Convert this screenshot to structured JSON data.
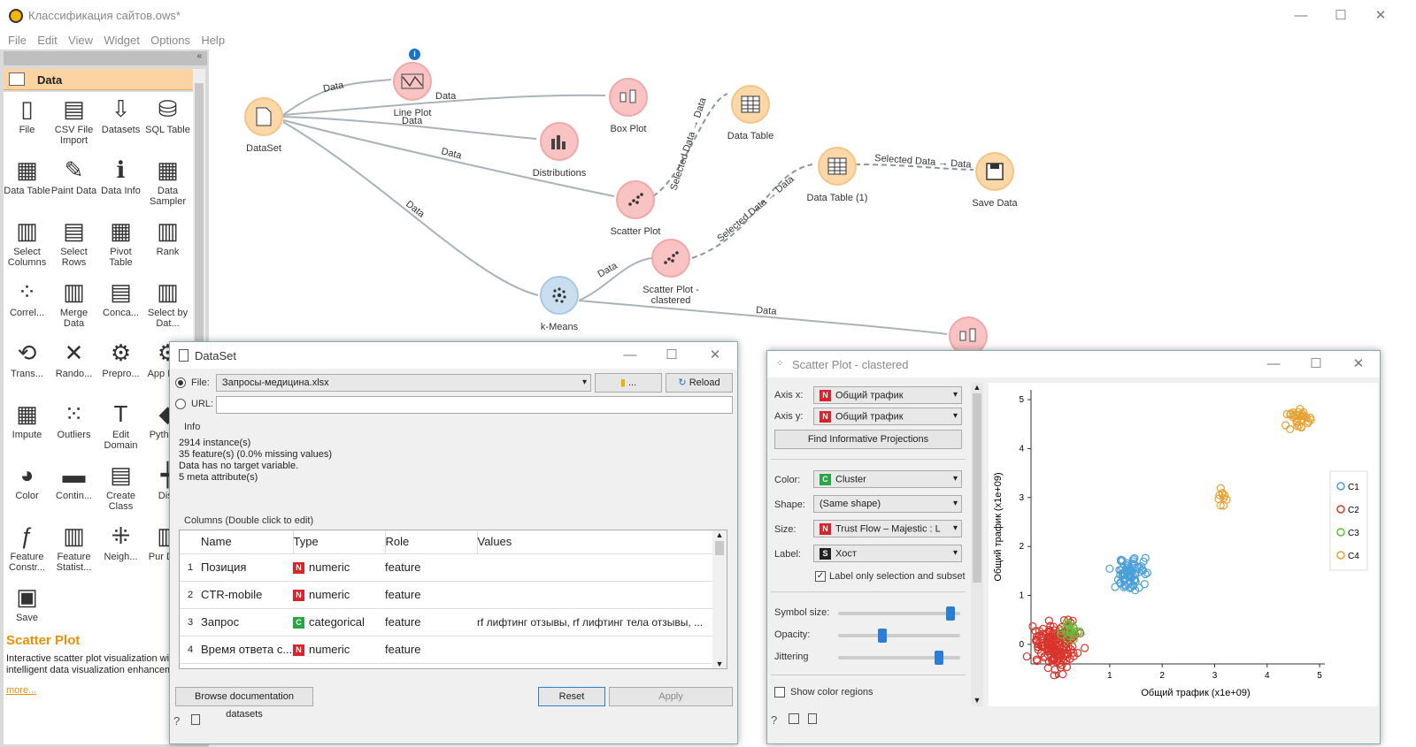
{
  "window": {
    "title": "Классификация сайтов.ows*"
  },
  "menu": [
    "File",
    "Edit",
    "View",
    "Widget",
    "Options",
    "Help"
  ],
  "toolbox": {
    "category": "Data",
    "tools": [
      {
        "label": "File",
        "icon": "file-icon"
      },
      {
        "label": "CSV File Import",
        "icon": "csv-icon"
      },
      {
        "label": "Datasets",
        "icon": "datasets-icon"
      },
      {
        "label": "SQL Table",
        "icon": "database-icon"
      },
      {
        "label": "Data Table",
        "icon": "table-icon"
      },
      {
        "label": "Paint Data",
        "icon": "paint-icon"
      },
      {
        "label": "Data Info",
        "icon": "info-icon"
      },
      {
        "label": "Data Sampler",
        "icon": "sampler-icon"
      },
      {
        "label": "Select Columns",
        "icon": "select-columns-icon"
      },
      {
        "label": "Select Rows",
        "icon": "select-rows-icon"
      },
      {
        "label": "Pivot Table",
        "icon": "pivot-icon"
      },
      {
        "label": "Rank",
        "icon": "rank-icon"
      },
      {
        "label": "Correl...",
        "icon": "correlations-icon"
      },
      {
        "label": "Merge Data",
        "icon": "merge-icon"
      },
      {
        "label": "Conca...",
        "icon": "concatenate-icon"
      },
      {
        "label": "Select by Dat...",
        "icon": "select-by-data-icon"
      },
      {
        "label": "Trans...",
        "icon": "transpose-icon"
      },
      {
        "label": "Rando...",
        "icon": "randomize-icon"
      },
      {
        "label": "Prepro...",
        "icon": "preprocess-icon"
      },
      {
        "label": "App Dom",
        "icon": "apply-domain-icon"
      },
      {
        "label": "Impute",
        "icon": "impute-icon"
      },
      {
        "label": "Outliers",
        "icon": "outliers-icon"
      },
      {
        "label": "Edit Domain",
        "icon": "edit-domain-icon"
      },
      {
        "label": "Pyth Scr",
        "icon": "python-icon"
      },
      {
        "label": "Color",
        "icon": "color-icon"
      },
      {
        "label": "Contin...",
        "icon": "continuize-icon"
      },
      {
        "label": "Create Class",
        "icon": "create-class-icon"
      },
      {
        "label": "Disc",
        "icon": "discretize-icon"
      },
      {
        "label": "Feature Constr...",
        "icon": "feature-constructor-icon"
      },
      {
        "label": "Feature Statist...",
        "icon": "feature-statistics-icon"
      },
      {
        "label": "Neigh...",
        "icon": "neighbors-icon"
      },
      {
        "label": "Pur Dom",
        "icon": "purge-domain-icon"
      },
      {
        "label": "Save",
        "icon": "save-icon"
      }
    ]
  },
  "help": {
    "title": "Scatter Plot",
    "text1": "Interactive scatter plot visualization wit",
    "text2": "intelligent data visualization enhancem",
    "more": "more..."
  },
  "workflow": {
    "nodes": {
      "dataset": "DataSet",
      "lineplot": "Line Plot",
      "boxplot": "Box Plot",
      "datatable": "Data Table",
      "distributions": "Distributions",
      "scatter": "Scatter Plot",
      "datatable1": "Data Table (1)",
      "savedata": "Save Data",
      "scatterclust": "Scatter Plot - clastered",
      "kmeans": "k-Means"
    },
    "links": {
      "data": "Data",
      "selected_data": "Selected Data → Data"
    }
  },
  "dataset_window": {
    "title": "DataSet",
    "file_label": "File:",
    "file_value": "Запросы-медицина.xlsx",
    "browse_label": "...",
    "reload_label": "Reload",
    "url_label": "URL:",
    "url_value": "",
    "info_header": "Info",
    "info_lines": [
      "2914 instance(s)",
      "35 feature(s) (0.0% missing values)",
      "Data has no target variable.",
      "5 meta attribute(s)"
    ],
    "columns_header": "Columns (Double click to edit)",
    "col_headers": [
      "Name",
      "Type",
      "Role",
      "Values"
    ],
    "rows": [
      {
        "idx": "1",
        "name": "Позиция",
        "tag": "N",
        "type": "numeric",
        "role": "feature",
        "values": ""
      },
      {
        "idx": "2",
        "name": "CTR-mobile",
        "tag": "N",
        "type": "numeric",
        "role": "feature",
        "values": ""
      },
      {
        "idx": "3",
        "name": "Запрос",
        "tag": "C",
        "type": "categorical",
        "role": "feature",
        "values": "rf лифтинг отзывы, rf лифтинг тела отзывы, ..."
      },
      {
        "idx": "4",
        "name": "Время ответа с...",
        "tag": "N",
        "type": "numeric",
        "role": "feature",
        "values": ""
      }
    ],
    "browse_docs": "Browse documentation datasets",
    "reset": "Reset",
    "apply": "Apply"
  },
  "scatter_window": {
    "title": "Scatter Plot - clastered",
    "axis_x_label": "Axis x:",
    "axis_x_value": "Общий трафик",
    "axis_y_label": "Axis y:",
    "axis_y_value": "Общий трафик",
    "find_projections": "Find Informative Projections",
    "color_label": "Color:",
    "color_value": "Cluster",
    "shape_label": "Shape:",
    "shape_value": "(Same shape)",
    "size_label": "Size:",
    "size_value": "Trust Flow – Majestic : L",
    "label_label": "Label:",
    "label_value": "Хост",
    "label_only": "Label only selection and subset",
    "symbol_size": "Symbol size:",
    "opacity": "Opacity:",
    "jittering": "Jittering",
    "symbol_size_value": 0.95,
    "opacity_value": 0.35,
    "jittering_value": 0.85,
    "show_regions": "Show color regions"
  },
  "chart_data": {
    "type": "scatter",
    "xlabel": "Общий трафик (x1e+09)",
    "ylabel": "Общий трафик (x1e+09)",
    "xlim": [
      -0.5,
      5.1
    ],
    "ylim": [
      -0.4,
      5.2
    ],
    "xticks": [
      "0",
      "1",
      "2",
      "3",
      "4",
      "5"
    ],
    "yticks": [
      "0",
      "1",
      "2",
      "3",
      "4",
      "5"
    ],
    "legend_placement": "right",
    "series": [
      {
        "name": "C1",
        "color": "#4a9fd8",
        "center": [
          1.45,
          1.45
        ],
        "spread": 0.16,
        "count": 70
      },
      {
        "name": "C2",
        "color": "#d9342c",
        "center": [
          0.0,
          0.0
        ],
        "spread": 0.22,
        "count": 160
      },
      {
        "name": "C3",
        "color": "#66bb3a",
        "center": [
          0.25,
          0.25
        ],
        "spread": 0.1,
        "count": 18
      },
      {
        "name": "C4",
        "color": "#e8a030",
        "center": [
          4.6,
          4.6
        ],
        "spread": 0.14,
        "count": 30
      },
      {
        "name": "C4",
        "color": "#e8a030",
        "center": [
          3.1,
          3.0
        ],
        "spread": 0.12,
        "count": 10
      }
    ]
  }
}
